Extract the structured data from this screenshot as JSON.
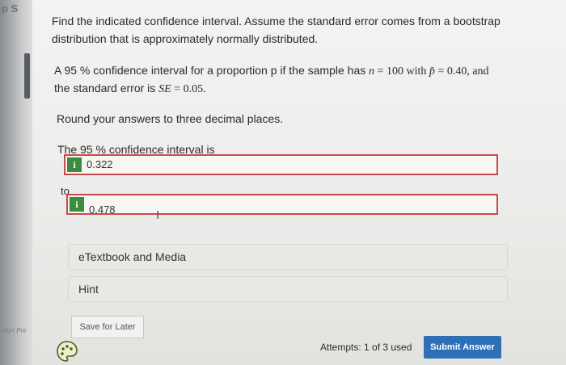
{
  "side": {
    "top_text": "p S",
    "bottom_text": "ufort   Pre"
  },
  "question": {
    "intro_line1": "Find the indicated confidence interval. Assume the standard error comes from a bootstrap",
    "intro_line2": "distribution that is approximately normally distributed.",
    "problem": {
      "p1": "A 95 % confidence interval for a proportion p if the sample has",
      "n_var": "n",
      "eq1": " = 100 with ",
      "phat": "p̂",
      "eq2": " = 0.40, and",
      "p2": "the standard error is ",
      "se_var": "SE",
      "eq3": " = 0.05."
    },
    "instruction": "Round your answers to three decimal places.",
    "interval_label": "The 95 % confidence interval is"
  },
  "answers": {
    "info_icon_glyph": "i",
    "lower": "0.322",
    "to_label": "to",
    "upper": "0.478"
  },
  "resources": {
    "etextbook": "eTextbook and Media",
    "hint": "Hint"
  },
  "footer": {
    "save_label": "Save for Later",
    "attempts": "Attempts: 1 of 3 used",
    "submit_label": "Submit Answer"
  },
  "colors": {
    "info_badge": "#3d8b3d",
    "answer_border": "#c94a4a",
    "submit_bg": "#2f6fb5"
  }
}
